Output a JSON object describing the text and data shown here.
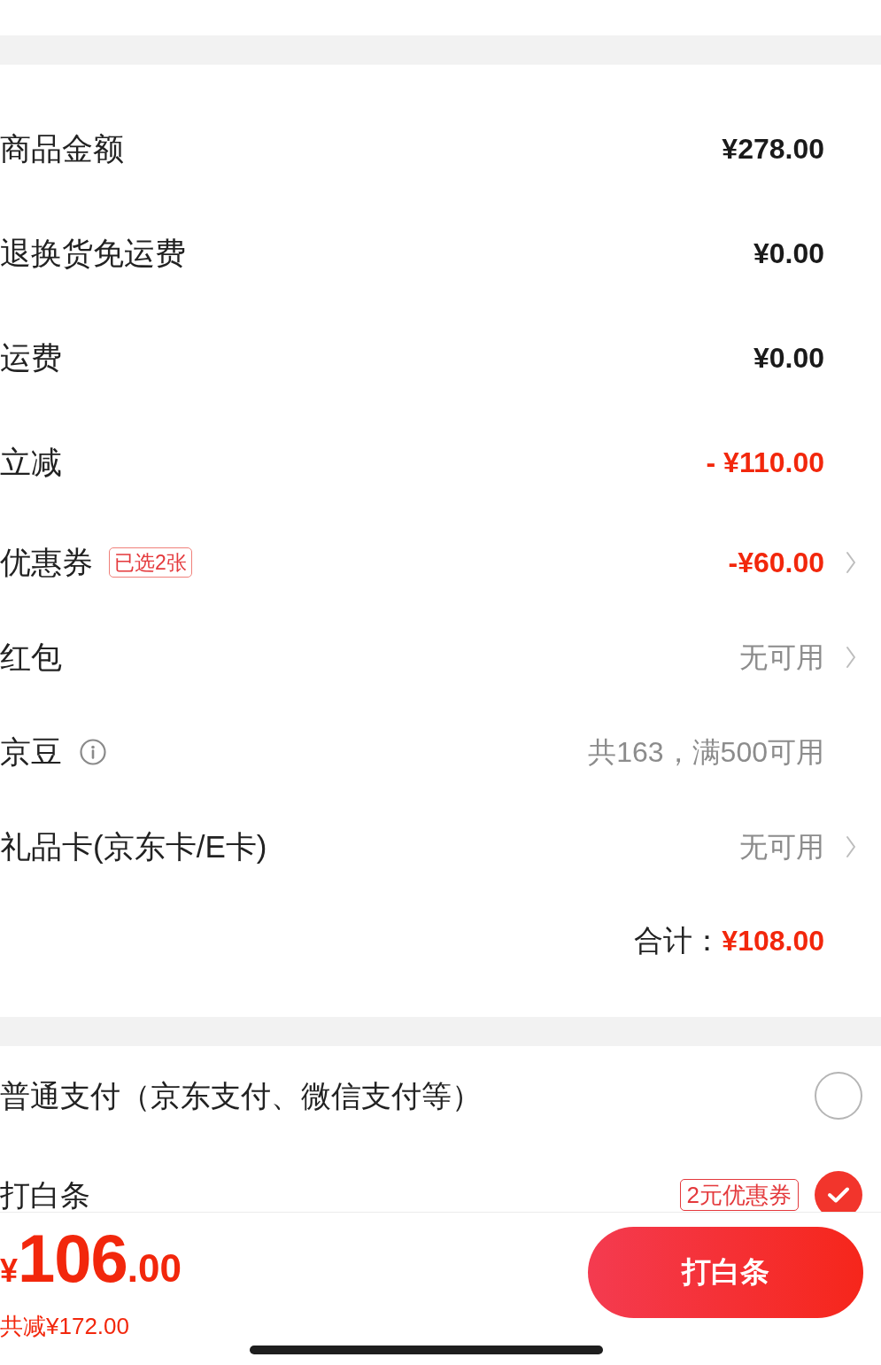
{
  "fee_rows": [
    {
      "label": "商品金额",
      "value": "¥278.00",
      "kind": "amount"
    },
    {
      "label": "退换货免运费",
      "value": "¥0.00",
      "kind": "amount"
    },
    {
      "label": "运费",
      "value": "¥0.00",
      "kind": "amount"
    },
    {
      "label": "立减",
      "value": "- ¥110.00",
      "kind": "discount"
    },
    {
      "label": "优惠券",
      "badge": "已选2张",
      "value": "-¥60.00",
      "kind": "discount",
      "chevron": true
    },
    {
      "label": "红包",
      "value": "无可用",
      "kind": "unavailable",
      "chevron": true
    },
    {
      "label": "京豆",
      "value": "共163，满500可用",
      "kind": "unavailable",
      "info": true
    },
    {
      "label": "礼品卡(京东卡/E卡)",
      "value": "无可用",
      "kind": "unavailable",
      "chevron": true
    }
  ],
  "total": {
    "label": "合计：",
    "value": "¥108.00"
  },
  "payment_methods": [
    {
      "label": "普通支付（京东支付、微信支付等）",
      "selected": false
    },
    {
      "label": "打白条",
      "badge": "2元优惠券",
      "selected": true
    }
  ],
  "bottom_bar": {
    "price": {
      "symbol": "¥",
      "integer": "106",
      "fraction": ".00"
    },
    "saving": "共减¥172.00",
    "button": "打白条"
  }
}
